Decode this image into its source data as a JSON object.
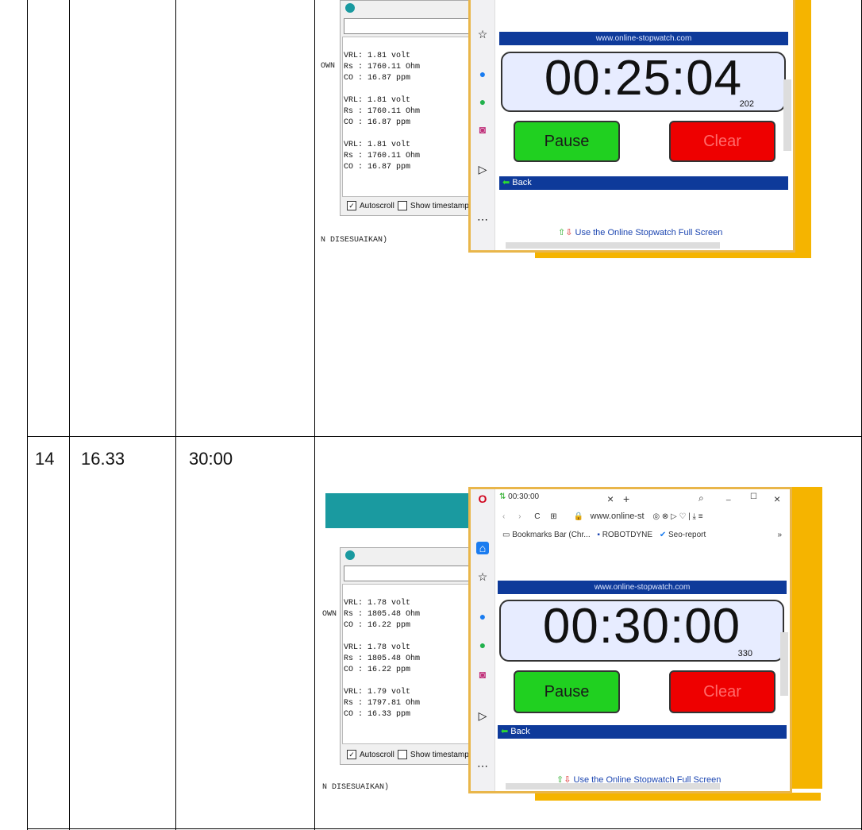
{
  "row1": {
    "serial_lines": [
      "VRL: 1.81 volt",
      "Rs : 1760.11 Ohm",
      "CO : 16.87 ppm",
      "",
      "VRL: 1.81 volt",
      "Rs : 1760.11 Ohm",
      "CO : 16.87 ppm",
      "",
      "VRL: 1.81 volt",
      "Rs : 1760.11 Ohm",
      "CO : 16.87 ppm"
    ],
    "side_top": "OWN",
    "side_bottom": "N DISESUAIKAN)",
    "autoscroll": "Autoscroll",
    "show_timestamp": "Show timestamp",
    "site": "www.online-stopwatch.com",
    "time": "00:25:04",
    "ms": "202",
    "pause": "Pause",
    "clear": "Clear",
    "back": "Back",
    "fullscreen": "Use the Online Stopwatch Full Screen"
  },
  "row2": {
    "number": "14",
    "value": "16.33",
    "time_cell": "30:00",
    "serial_lines": [
      "VRL: 1.78 volt",
      "Rs : 1805.48 Ohm",
      "CO : 16.22 ppm",
      "",
      "VRL: 1.78 volt",
      "Rs : 1805.48 Ohm",
      "CO : 16.22 ppm",
      "",
      "VRL: 1.79 volt",
      "Rs : 1797.81 Ohm",
      "CO : 16.33 ppm"
    ],
    "side_top": "OWN",
    "side_bottom": "N DISESUAIKAN)",
    "autoscroll": "Autoscroll",
    "show_timestamp": "Show timestamp",
    "tab_title": "00:30:00",
    "address": "www.online-st",
    "bookmarks": [
      "Bookmarks Bar (Chr...",
      "ROBOTDYNE",
      "Seo-report"
    ],
    "site": "www.online-stopwatch.com",
    "time": "00:30:00",
    "ms": "330",
    "pause": "Pause",
    "clear": "Clear",
    "back": "Back",
    "fullscreen": "Use the Online Stopwatch Full Screen"
  },
  "colors": {
    "accent_blue": "#0e3a9a",
    "pause_green": "#20d020",
    "clear_red": "#ee0000",
    "arduino_teal": "#1a9aa0"
  }
}
